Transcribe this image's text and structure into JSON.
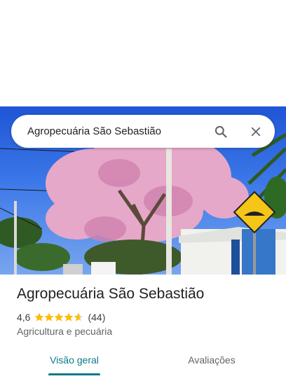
{
  "search": {
    "query": "Agropecuária São Sebastião",
    "search_icon": "search-icon",
    "close_icon": "close-icon"
  },
  "place": {
    "name": "Agropecuária São Sebastião",
    "rating": "4,6",
    "rating_value": 4.6,
    "reviews_count": "(44)",
    "category": "Agricultura e pecuária"
  },
  "tabs": [
    {
      "label": "Visão geral",
      "selected": true
    },
    {
      "label": "Avaliações",
      "selected": false
    }
  ],
  "colors": {
    "accent": "#0b7a8a",
    "star": "#fbbc04",
    "sign": "#f5c518"
  }
}
